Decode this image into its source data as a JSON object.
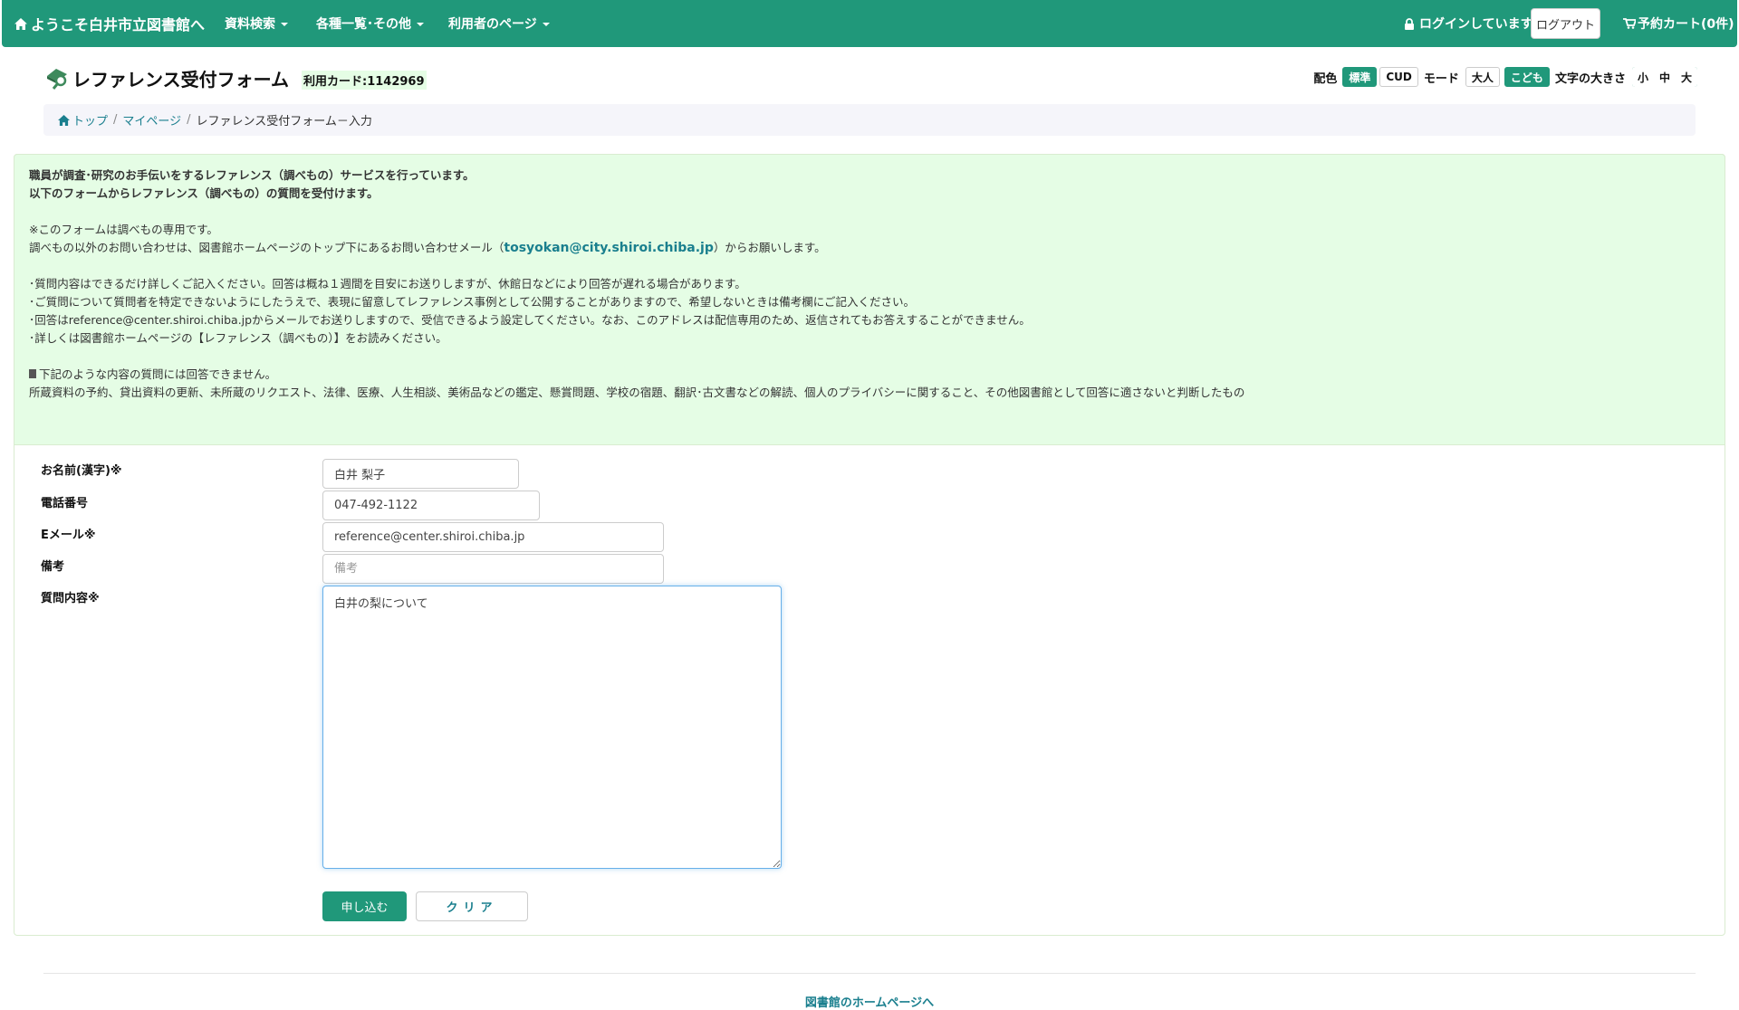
{
  "navbar": {
    "brand": "ようこそ白井市立図書館へ",
    "menus": [
      "資料検索",
      "各種一覧･その他",
      "利用者のページ"
    ],
    "login_status": "ログインしています",
    "logout_label": "ログアウト",
    "cart_label": "予約カート(0件)"
  },
  "header": {
    "title": "レファレンス受付フォーム",
    "card_number": "利用カード:1142969"
  },
  "prefs": {
    "color_label": "配色",
    "color_options": [
      "標準",
      "CUD"
    ],
    "color_selected": "標準",
    "mode_label": "モード",
    "mode_options": [
      "大人",
      "こども"
    ],
    "mode_selected": "こども",
    "size_label": "文字の大きさ",
    "size_options": [
      "小",
      "中",
      "大"
    ],
    "size_selected": "中"
  },
  "breadcrumb": {
    "items": [
      "トップ",
      "マイページ",
      "レファレンス受付フォーム－入力"
    ]
  },
  "info": {
    "lead1": "職員が調査･研究のお手伝いをするレファレンス（調べもの）サービスを行っています。",
    "lead2": "以下のフォームからレファレンス（調べもの）の質問を受付けます。",
    "note1": "※このフォームは調べもの専用です。",
    "note2_before": "調べもの以外のお問い合わせは、図書館ホームページのトップ下にあるお問い合わせメール（",
    "note2_email": "tosyokan@city.shiroi.chiba.jp",
    "note2_after": "）からお願いします。",
    "bullets": [
      "･質問内容はできるだけ詳しくご記入ください。回答は概ね１週間を目安にお送りしますが、休館日などにより回答が遅れる場合があります。",
      "･ご質問について質問者を特定できないようにしたうえで、表現に留意してレファレンス事例として公開することがありますので、希望しないときは備考欄にご記入ください。",
      "･回答はreference@center.shiroi.chiba.jpからメールでお送りしますので、受信できるよう設定してください。なお、このアドレスは配信専用のため、返信されてもお答えすることができません。",
      "･詳しくは図書館ホームページの【レファレンス（調べもの）】をお読みください。"
    ],
    "not_answerable_heading": "下記のような内容の質問には回答できません。",
    "not_answerable_list": "所蔵資料の予約、貸出資料の更新、未所蔵のリクエスト、法律、医療、人生相談、美術品などの鑑定、懸賞問題、学校の宿題、翻訳･古文書などの解読、個人のプライバシーに関すること、その他図書館として回答に適さないと判断したもの"
  },
  "form": {
    "name_label": "お名前(漢字)※",
    "name_value": "白井 梨子",
    "phone_label": "電話番号",
    "phone_value": "047-492-1122",
    "email_label": "Eメール※",
    "email_value": "reference@center.shiroi.chiba.jp",
    "note_label": "備考",
    "note_placeholder": "備考",
    "question_label": "質問内容※",
    "question_value": "白井の梨について",
    "submit_label": "申し込む",
    "clear_label": "クリア"
  },
  "footer": {
    "link_label": "図書館のホームページへ"
  },
  "colors": {
    "brand": "#20987a",
    "link": "#1a7f8e",
    "info_bg": "#e5fde5"
  }
}
